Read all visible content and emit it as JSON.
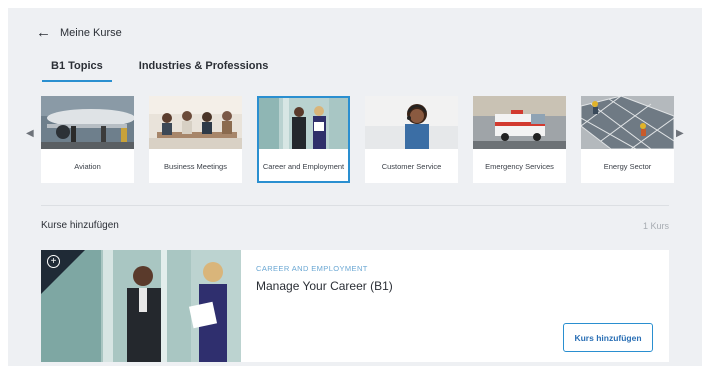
{
  "nav": {
    "back_label": "Meine Kurse",
    "back_icon": "arrow-left-icon"
  },
  "tabs": [
    {
      "label": "B1 Topics",
      "active": true
    },
    {
      "label": "Industries & Professions",
      "active": false
    }
  ],
  "carousel": {
    "prev_icon": "chevron-left-icon",
    "next_icon": "chevron-right-icon",
    "topics": [
      {
        "label": "Aviation",
        "selected": false
      },
      {
        "label": "Business Meetings",
        "selected": false
      },
      {
        "label": "Career and Employment",
        "selected": true
      },
      {
        "label": "Customer Service",
        "selected": false
      },
      {
        "label": "Emergency Services",
        "selected": false
      },
      {
        "label": "Energy Sector",
        "selected": false
      }
    ]
  },
  "courses_section": {
    "title": "Kurse hinzufügen",
    "count": "1 Kurs"
  },
  "course": {
    "category": "CAREER AND EMPLOYMENT",
    "title": "Manage Your Career (B1)",
    "add_label": "Kurs hinzufügen",
    "add_icon": "plus-circle-icon"
  },
  "colors": {
    "accent": "#2a8fd0",
    "background": "#eef0f3",
    "category_text": "#6aa7d3"
  }
}
